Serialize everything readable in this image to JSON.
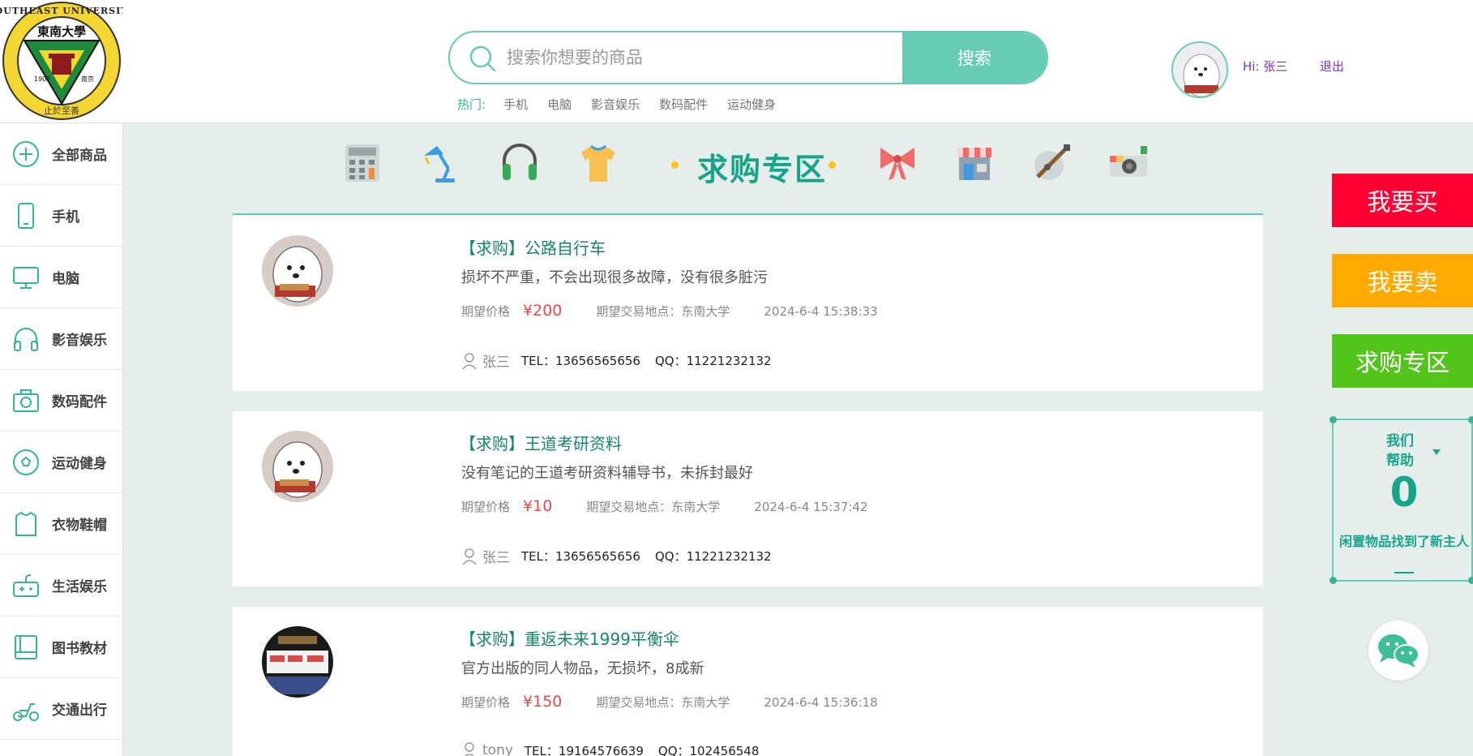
{
  "header": {
    "logo": {
      "text_top": "SOUTHEAST UNIVERSITY",
      "text_center": "東南大學",
      "year": "1902",
      "city": "南京",
      "motto": "止於至善"
    },
    "search": {
      "placeholder": "搜索你想要的商品",
      "button_label": "搜索"
    },
    "hot": {
      "label": "热门:",
      "items": [
        "手机",
        "电脑",
        "影音娱乐",
        "数码配件",
        "运动健身"
      ]
    },
    "user": {
      "greeting": "Hi: 张三",
      "logout": "退出"
    }
  },
  "sidebar": {
    "items": [
      {
        "label": "全部商品",
        "icon": "plus-circle-icon"
      },
      {
        "label": "手机",
        "icon": "phone-icon"
      },
      {
        "label": "电脑",
        "icon": "monitor-icon"
      },
      {
        "label": "影音娱乐",
        "icon": "headphones-icon"
      },
      {
        "label": "数码配件",
        "icon": "camera-icon"
      },
      {
        "label": "运动健身",
        "icon": "soccer-ball-icon"
      },
      {
        "label": "衣物鞋帽",
        "icon": "shirt-icon"
      },
      {
        "label": "生活娱乐",
        "icon": "gamepad-icon"
      },
      {
        "label": "图书教材",
        "icon": "book-icon"
      },
      {
        "label": "交通出行",
        "icon": "scooter-icon"
      }
    ]
  },
  "category_bar": {
    "title": "求购专区",
    "icons": [
      "calculator-icon",
      "desk-lamp-icon",
      "headphones-icon",
      "t-shirt-icon",
      "bow-icon",
      "shop-icon",
      "guitar-icon",
      "camera-icon"
    ]
  },
  "listings": [
    {
      "tag": "【求购】",
      "title": "公路自行车",
      "desc": "损坏不严重，不会出现很多故障，没有很多脏污",
      "price_label": "期望价格",
      "price": "¥200",
      "address": "期望交易地点：东南大学",
      "time": "2024-6-4 15:38:33",
      "user": "张三",
      "tel": "TEL：13656565656",
      "qq": "QQ：11221232132"
    },
    {
      "tag": "【求购】",
      "title": "王道考研资料",
      "desc": "没有笔记的王道考研资料辅导书，未拆封最好",
      "price_label": "期望价格",
      "price": "¥10",
      "address": "期望交易地点：东南大学",
      "time": "2024-6-4 15:37:42",
      "user": "张三",
      "tel": "TEL：13656565656",
      "qq": "QQ：11221232132"
    },
    {
      "tag": "【求购】",
      "title": "重返未来1999平衡伞",
      "desc": "官方出版的同人物品，无损坏，8成新",
      "price_label": "期望价格",
      "price": "¥150",
      "address": "期望交易地点：东南大学",
      "time": "2024-6-4 15:36:18",
      "user": "tony",
      "tel": "TEL：19164576639",
      "qq": "QQ：102456548"
    }
  ],
  "right_panel": {
    "buy": {
      "label": "我要买",
      "color": "#ff0033"
    },
    "sell": {
      "label": "我要卖",
      "color": "#ffaa00"
    },
    "wanted": {
      "label": "求购专区",
      "color": "#52c41a"
    },
    "help_title": "我们帮助",
    "help_count": "0",
    "help_text": "闲置物品找到了新主人"
  },
  "colors": {
    "accent": "#66ccb4",
    "accent_dark": "#17a58a",
    "price": "#e84a4a",
    "background": "#e6eeec"
  }
}
